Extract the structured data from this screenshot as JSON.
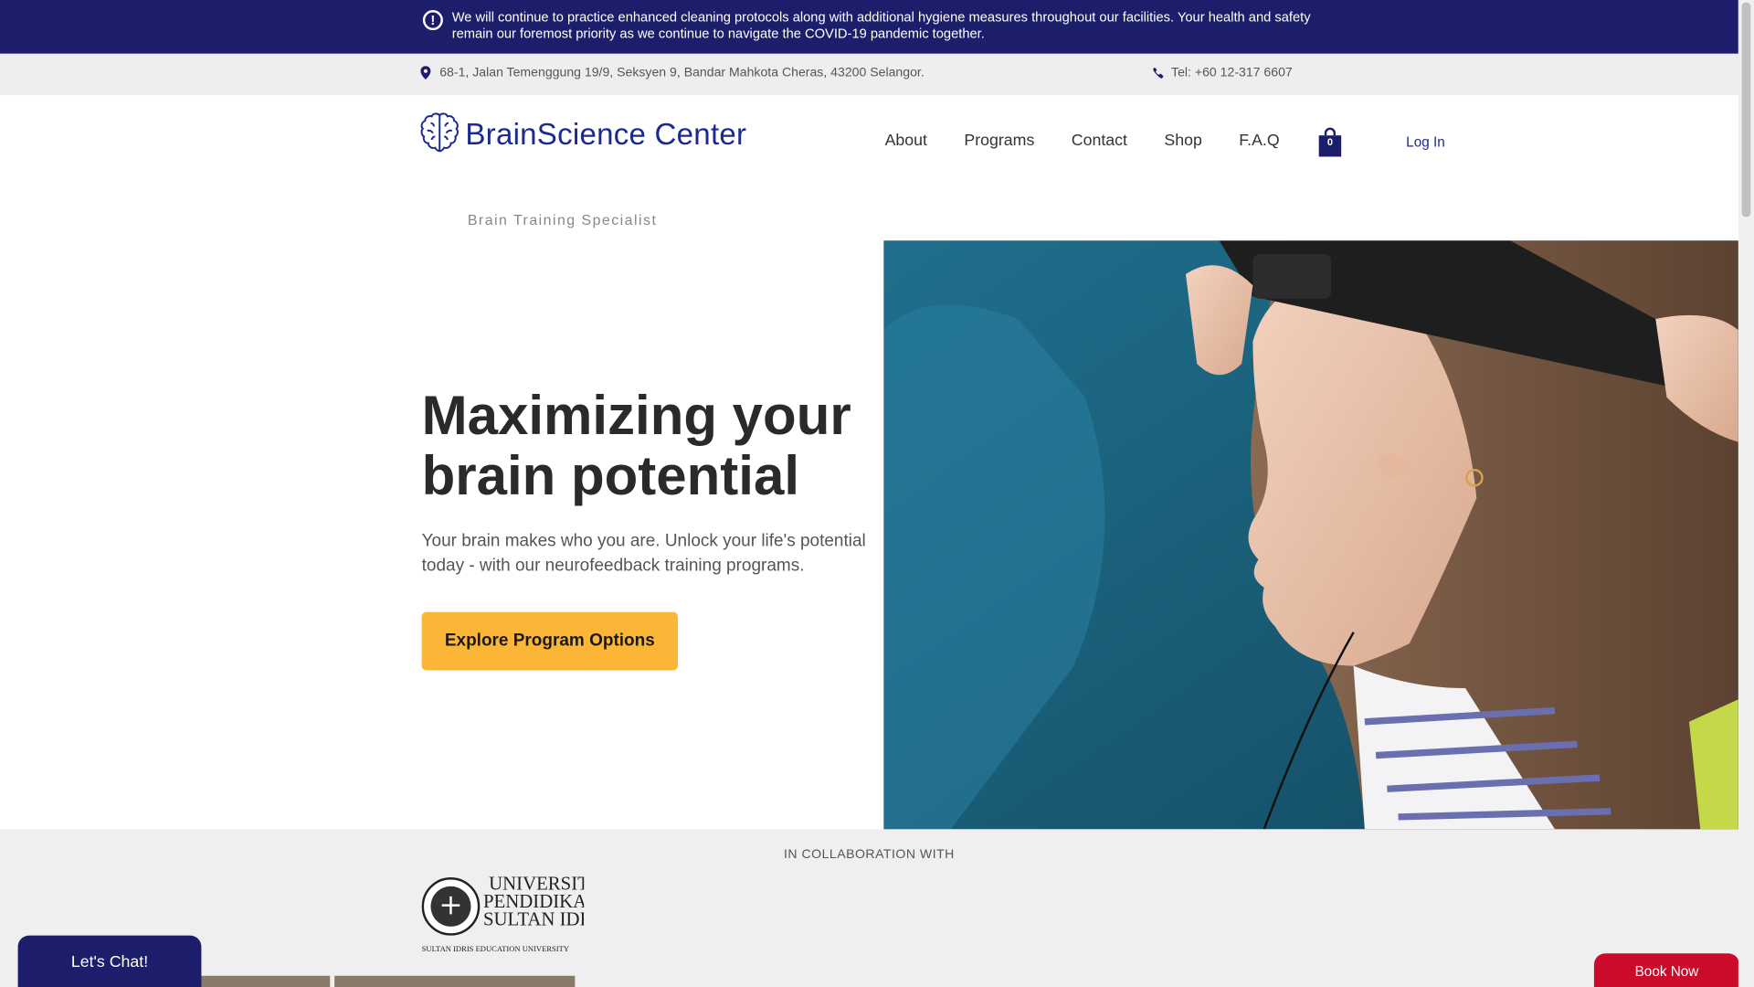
{
  "notice": {
    "icon": "alert-circle-icon",
    "text": "We will continue to practice enhanced cleaning protocols along with additional hygiene measures throughout our facilities. Your health and safety remain our foremost priority as we continue to navigate the COVID-19 pandemic together."
  },
  "topbar": {
    "address": "68-1, Jalan Temenggung 19/9, Seksyen 9, Bandar Mahkota Cheras, 43200 Selangor.",
    "phone": "Tel: +60 12-317 6607"
  },
  "header": {
    "logo_text": "BrainScience Center",
    "nav": [
      "About",
      "Programs",
      "Contact",
      "Shop",
      "F.A.Q"
    ],
    "cart_count": "0",
    "login": "Log In"
  },
  "hero": {
    "tagline": "Brain Training Specialist",
    "headline": "Maximizing your brain potential",
    "subtext": "Your brain makes who you are. Unlock your life's potential today - with our neurofeedback training programs.",
    "cta": "Explore Program Options"
  },
  "collab": {
    "label": "IN COLLABORATION WITH",
    "partner_lines": [
      "UNIVERSITI",
      "PENDIDIKAN",
      "SULTAN IDRIS"
    ],
    "partner_sub": "SULTAN IDRIS EDUCATION UNIVERSITY"
  },
  "widgets": {
    "chat": "Let's Chat!",
    "book": "Book Now"
  },
  "colors": {
    "brand_navy": "#1c1e6b",
    "logo_blue": "#1c2a8f",
    "cta_yellow": "#fbb537",
    "book_red": "#cc0a2a"
  }
}
